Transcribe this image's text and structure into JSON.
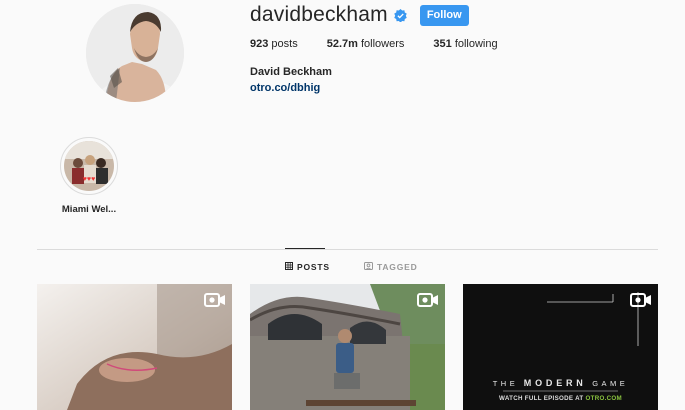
{
  "profile": {
    "username": "davidbeckham",
    "verified_icon": "verified-badge-icon",
    "follow_label": "Follow",
    "stats": {
      "posts_count": "923",
      "posts_label": "posts",
      "followers_count": "52.7m",
      "followers_label": "followers",
      "following_count": "351",
      "following_label": "following"
    },
    "full_name": "David Beckham",
    "link": "otro.co/dbhig"
  },
  "highlights": [
    {
      "label": "Miami Wel..."
    }
  ],
  "tabs": [
    {
      "label": "POSTS",
      "icon": "grid-icon",
      "active": true
    },
    {
      "label": "TAGGED",
      "icon": "tag-icon",
      "active": false
    }
  ],
  "posts": [
    {
      "type": "video",
      "icon": "video-icon"
    },
    {
      "type": "video",
      "icon": "video-icon"
    },
    {
      "type": "video",
      "icon": "video-icon",
      "overlay_title_pre": "THE ",
      "overlay_title_main": "MODERN",
      "overlay_title_post": " GAME",
      "overlay_sub_pre": "WATCH FULL EPISODE AT ",
      "overlay_sub_link": "OTRO.COM"
    }
  ],
  "colors": {
    "follow_button": "#3897f0",
    "link": "#003569",
    "verified": "#3897f0",
    "accent_green": "#8bc53f"
  }
}
